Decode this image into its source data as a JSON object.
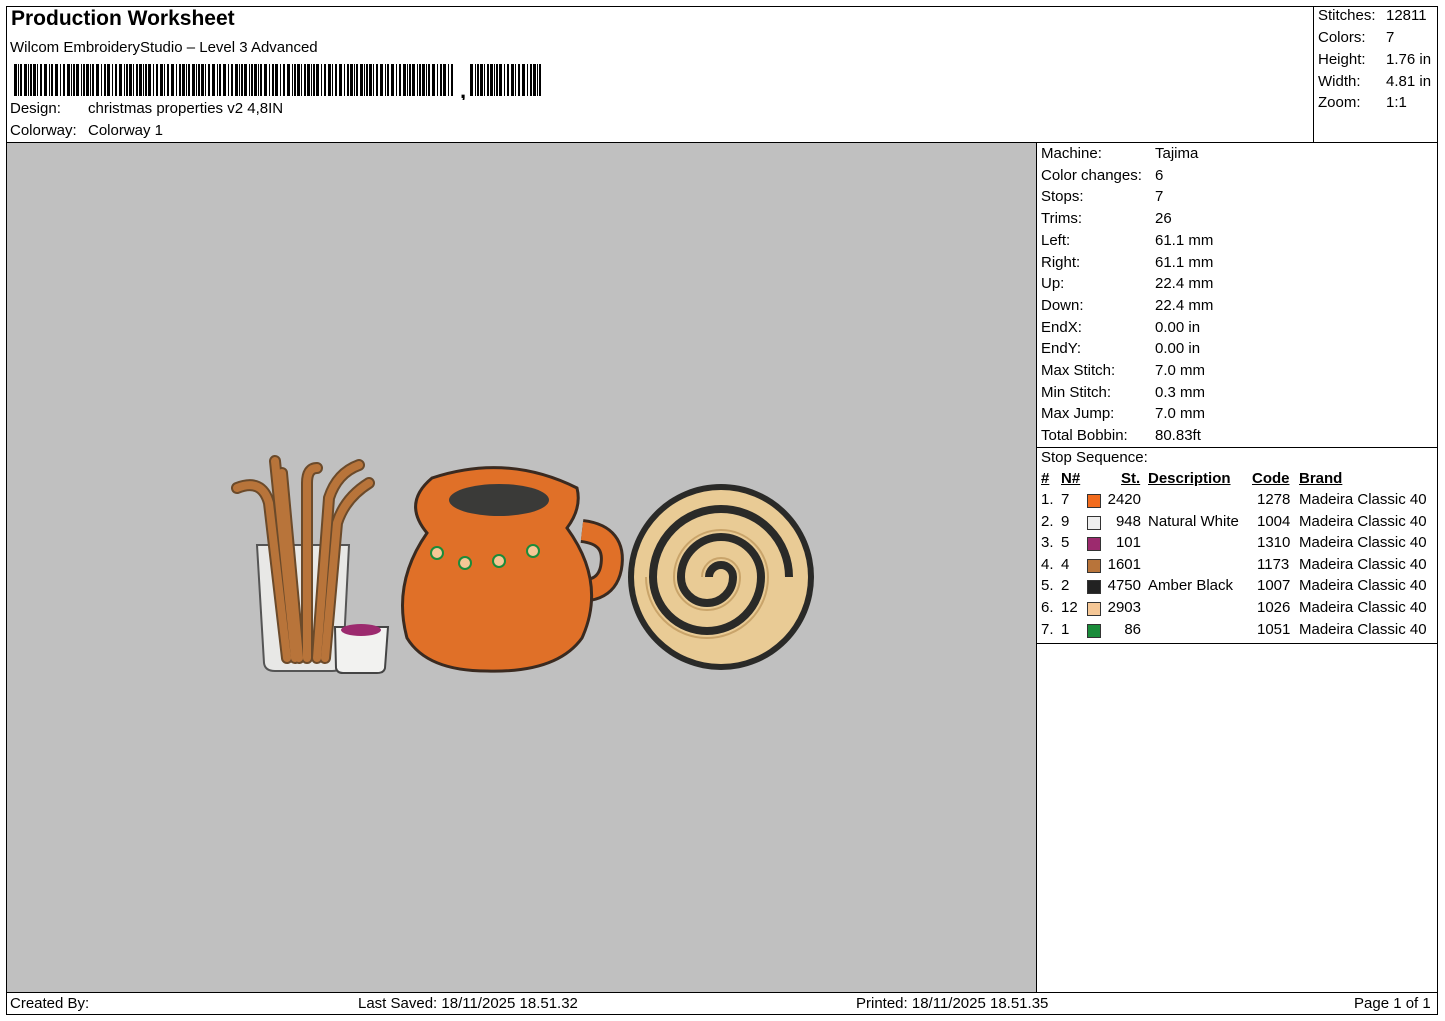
{
  "header": {
    "title": "Production Worksheet",
    "software": "Wilcom EmbroideryStudio – Level 3 Advanced",
    "barcode_suffix": ",",
    "design_label": "Design:",
    "design_value": "christmas properties v2 4,8IN",
    "colorway_label": "Colorway:",
    "colorway_value": "Colorway 1"
  },
  "stats": [
    {
      "label": "Stitches:",
      "value": "12811"
    },
    {
      "label": "Colors:",
      "value": "7"
    },
    {
      "label": "Height:",
      "value": "1.76 in"
    },
    {
      "label": "Width:",
      "value": "4.81 in"
    },
    {
      "label": "Zoom:",
      "value": "1:1"
    }
  ],
  "machine_info": [
    {
      "label": "Machine:",
      "value": "Tajima"
    },
    {
      "label": "Color changes:",
      "value": "6"
    },
    {
      "label": "Stops:",
      "value": "7"
    },
    {
      "label": "Trims:",
      "value": "26"
    },
    {
      "label": "Left:",
      "value": "61.1 mm"
    },
    {
      "label": "Right:",
      "value": "61.1 mm"
    },
    {
      "label": "Up:",
      "value": "22.4 mm"
    },
    {
      "label": "Down:",
      "value": "22.4 mm"
    },
    {
      "label": "EndX:",
      "value": "0.00 in"
    },
    {
      "label": "EndY:",
      "value": "0.00 in"
    },
    {
      "label": "Max Stitch:",
      "value": "7.0 mm"
    },
    {
      "label": "Min Stitch:",
      "value": "0.3 mm"
    },
    {
      "label": "Max Jump:",
      "value": "7.0 mm"
    },
    {
      "label": "Total Bobbin:",
      "value": "80.83ft"
    }
  ],
  "stop_sequence": {
    "title": "Stop Sequence:",
    "headers": {
      "num": "#",
      "n": "N#",
      "st": "St.",
      "desc": "Description",
      "code": "Code",
      "brand": "Brand"
    },
    "rows": [
      {
        "num": "1.",
        "n": "7",
        "color": "#f26b1d",
        "st": "2420",
        "desc": "",
        "code": "1278",
        "brand": "Madeira Classic 40"
      },
      {
        "num": "2.",
        "n": "9",
        "color": "#eeeeee",
        "st": "948",
        "desc": "Natural White",
        "code": "1004",
        "brand": "Madeira Classic 40"
      },
      {
        "num": "3.",
        "n": "5",
        "color": "#9c2a6e",
        "st": "101",
        "desc": "",
        "code": "1310",
        "brand": "Madeira Classic 40"
      },
      {
        "num": "4.",
        "n": "4",
        "color": "#b8743a",
        "st": "1601",
        "desc": "",
        "code": "1173",
        "brand": "Madeira Classic 40"
      },
      {
        "num": "5.",
        "n": "2",
        "color": "#222222",
        "st": "4750",
        "desc": "Amber Black",
        "code": "1007",
        "brand": "Madeira Classic 40"
      },
      {
        "num": "6.",
        "n": "12",
        "color": "#f5c796",
        "st": "2903",
        "desc": "",
        "code": "1026",
        "brand": "Madeira Classic 40"
      },
      {
        "num": "7.",
        "n": "1",
        "color": "#1a8c3a",
        "st": "86",
        "desc": "",
        "code": "1051",
        "brand": "Madeira Classic 40"
      }
    ]
  },
  "footer": {
    "created_by": "Created By:",
    "last_saved": "Last Saved: 18/11/2025 18.51.32",
    "printed": "Printed: 18/11/2025 18.51.35",
    "page": "Page 1 of 1"
  }
}
